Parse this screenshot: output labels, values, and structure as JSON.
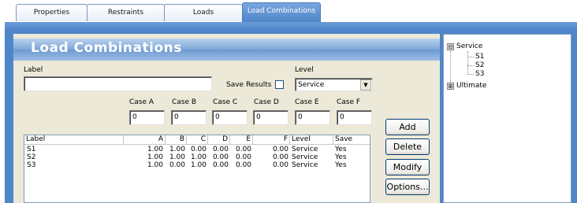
{
  "tabs": [
    {
      "label": "Properties",
      "active": false
    },
    {
      "label": "Restraints",
      "active": false
    },
    {
      "label": "Loads",
      "active": false
    },
    {
      "label": "Load Combinations",
      "active": true
    }
  ],
  "panel": {
    "title": "Load Combinations",
    "label_caption": "Label",
    "label_value": "",
    "save_results_label": "Save Results",
    "save_results_checked": false,
    "level_caption": "Level",
    "level_value": "Service"
  },
  "cases": [
    {
      "label": "Case A",
      "value": "0"
    },
    {
      "label": "Case B",
      "value": "0"
    },
    {
      "label": "Case C",
      "value": "0"
    },
    {
      "label": "Case D",
      "value": "0"
    },
    {
      "label": "Case E",
      "value": "0"
    },
    {
      "label": "Case F",
      "value": "0"
    }
  ],
  "table": {
    "columns": [
      "Label",
      "A",
      "B",
      "C",
      "D",
      "E",
      "F",
      "Level",
      "Save"
    ],
    "rows": [
      [
        "S1",
        "1.00",
        "1.00",
        "0.00",
        "0.00",
        "0.00",
        "0.00",
        "Service",
        "Yes"
      ],
      [
        "S2",
        "1.00",
        "1.00",
        "1.00",
        "0.00",
        "0.00",
        "0.00",
        "Service",
        "Yes"
      ],
      [
        "S3",
        "1.00",
        "0.00",
        "1.00",
        "0.00",
        "0.00",
        "0.00",
        "Service",
        "Yes"
      ]
    ]
  },
  "buttons": {
    "add": "Add",
    "delete": "Delete",
    "modify": "Modify",
    "options": "Options..."
  },
  "tree": {
    "service": {
      "label": "Service",
      "expander": "⊟",
      "children": [
        "S1",
        "S2",
        "S3"
      ]
    },
    "ultimate": {
      "label": "Ultimate",
      "expander": "⊞"
    }
  },
  "colors": {
    "accent": "#4f86c9",
    "panel": "#ece9d8"
  }
}
